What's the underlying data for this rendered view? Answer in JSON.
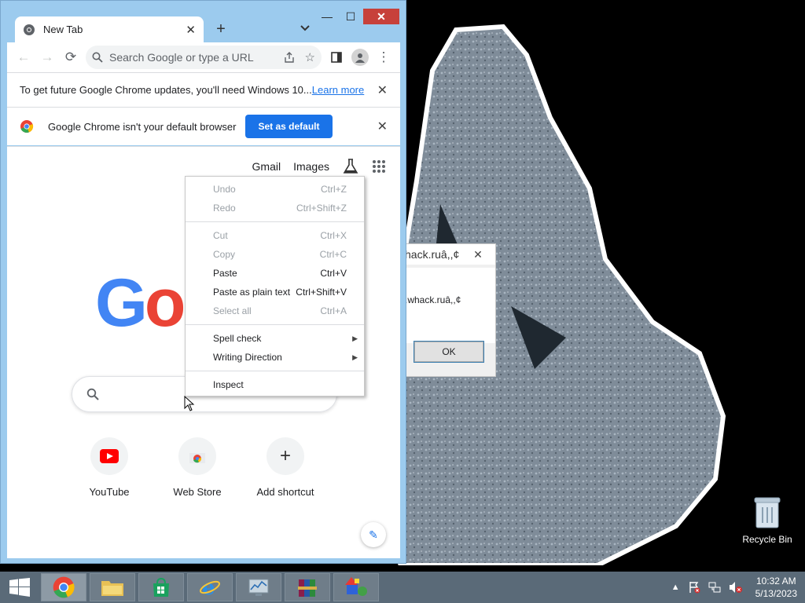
{
  "browser": {
    "tab_title": "New Tab",
    "omnibox_placeholder": "Search Google or type a URL"
  },
  "infobar_update": {
    "text": "To get future Google Chrome updates, you'll need Windows 10...",
    "link": "Learn more"
  },
  "infobar_default": {
    "text": "Google Chrome isn't your default browser",
    "button": "Set as default"
  },
  "ntp": {
    "gmail": "Gmail",
    "images": "Images",
    "logo_blue": "G",
    "logo_red": "o",
    "shortcuts": [
      {
        "label": "YouTube"
      },
      {
        "label": "Web Store"
      },
      {
        "label": "Add shortcut"
      }
    ]
  },
  "context_menu": {
    "undo": {
      "label": "Undo",
      "shortcut": "Ctrl+Z"
    },
    "redo": {
      "label": "Redo",
      "shortcut": "Ctrl+Shift+Z"
    },
    "cut": {
      "label": "Cut",
      "shortcut": "Ctrl+X"
    },
    "copy": {
      "label": "Copy",
      "shortcut": "Ctrl+C"
    },
    "paste": {
      "label": "Paste",
      "shortcut": "Ctrl+V"
    },
    "paste_plain": {
      "label": "Paste as plain text",
      "shortcut": "Ctrl+Shift+V"
    },
    "select_all": {
      "label": "Select all",
      "shortcut": "Ctrl+A"
    },
    "spell_check": {
      "label": "Spell check"
    },
    "writing_direction": {
      "label": "Writing Direction"
    },
    "inspect": {
      "label": "Inspect"
    }
  },
  "dialog": {
    "title": "hack.ruâ,,¢",
    "message": ".whack.ruâ,,¢",
    "ok": "OK"
  },
  "desktop": {
    "recycle_bin": "Recycle Bin"
  },
  "clock": {
    "time": "10:32 AM",
    "date": "5/13/2023"
  }
}
